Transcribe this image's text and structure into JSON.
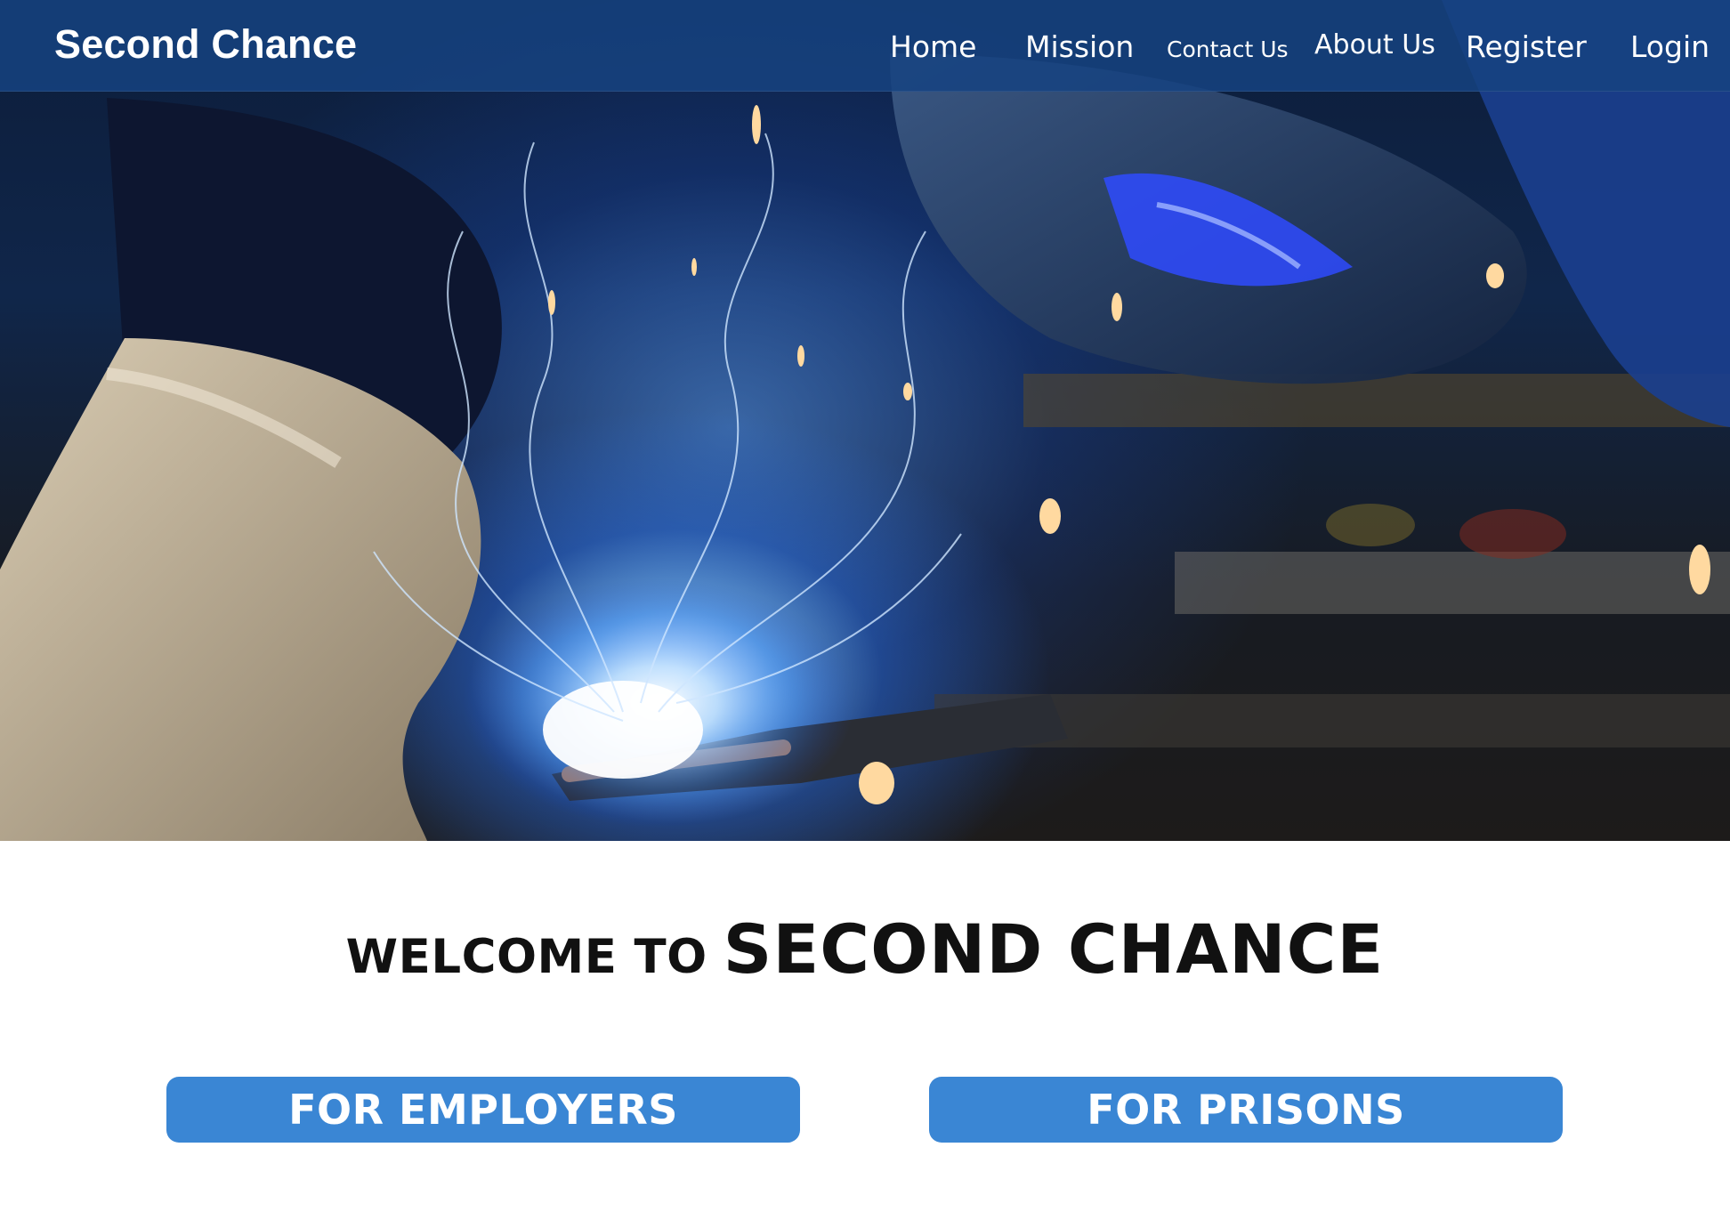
{
  "brand": {
    "name": "Second Chance"
  },
  "nav": {
    "items": [
      {
        "label": "Home"
      },
      {
        "label": "Mission"
      },
      {
        "label": "Contact Us"
      },
      {
        "label": "About Us"
      },
      {
        "label": "Register"
      },
      {
        "label": "Login"
      }
    ]
  },
  "hero": {
    "image": "welder-sparks-photo"
  },
  "welcome": {
    "prefix": "WELCOME TO",
    "name": "SECOND CHANCE"
  },
  "cta": {
    "employers_label": "FOR EMPLOYERS",
    "prisons_label": "FOR PRISONS"
  },
  "colors": {
    "navbar": "#164280",
    "button": "#3a86d4",
    "text": "#111111"
  }
}
